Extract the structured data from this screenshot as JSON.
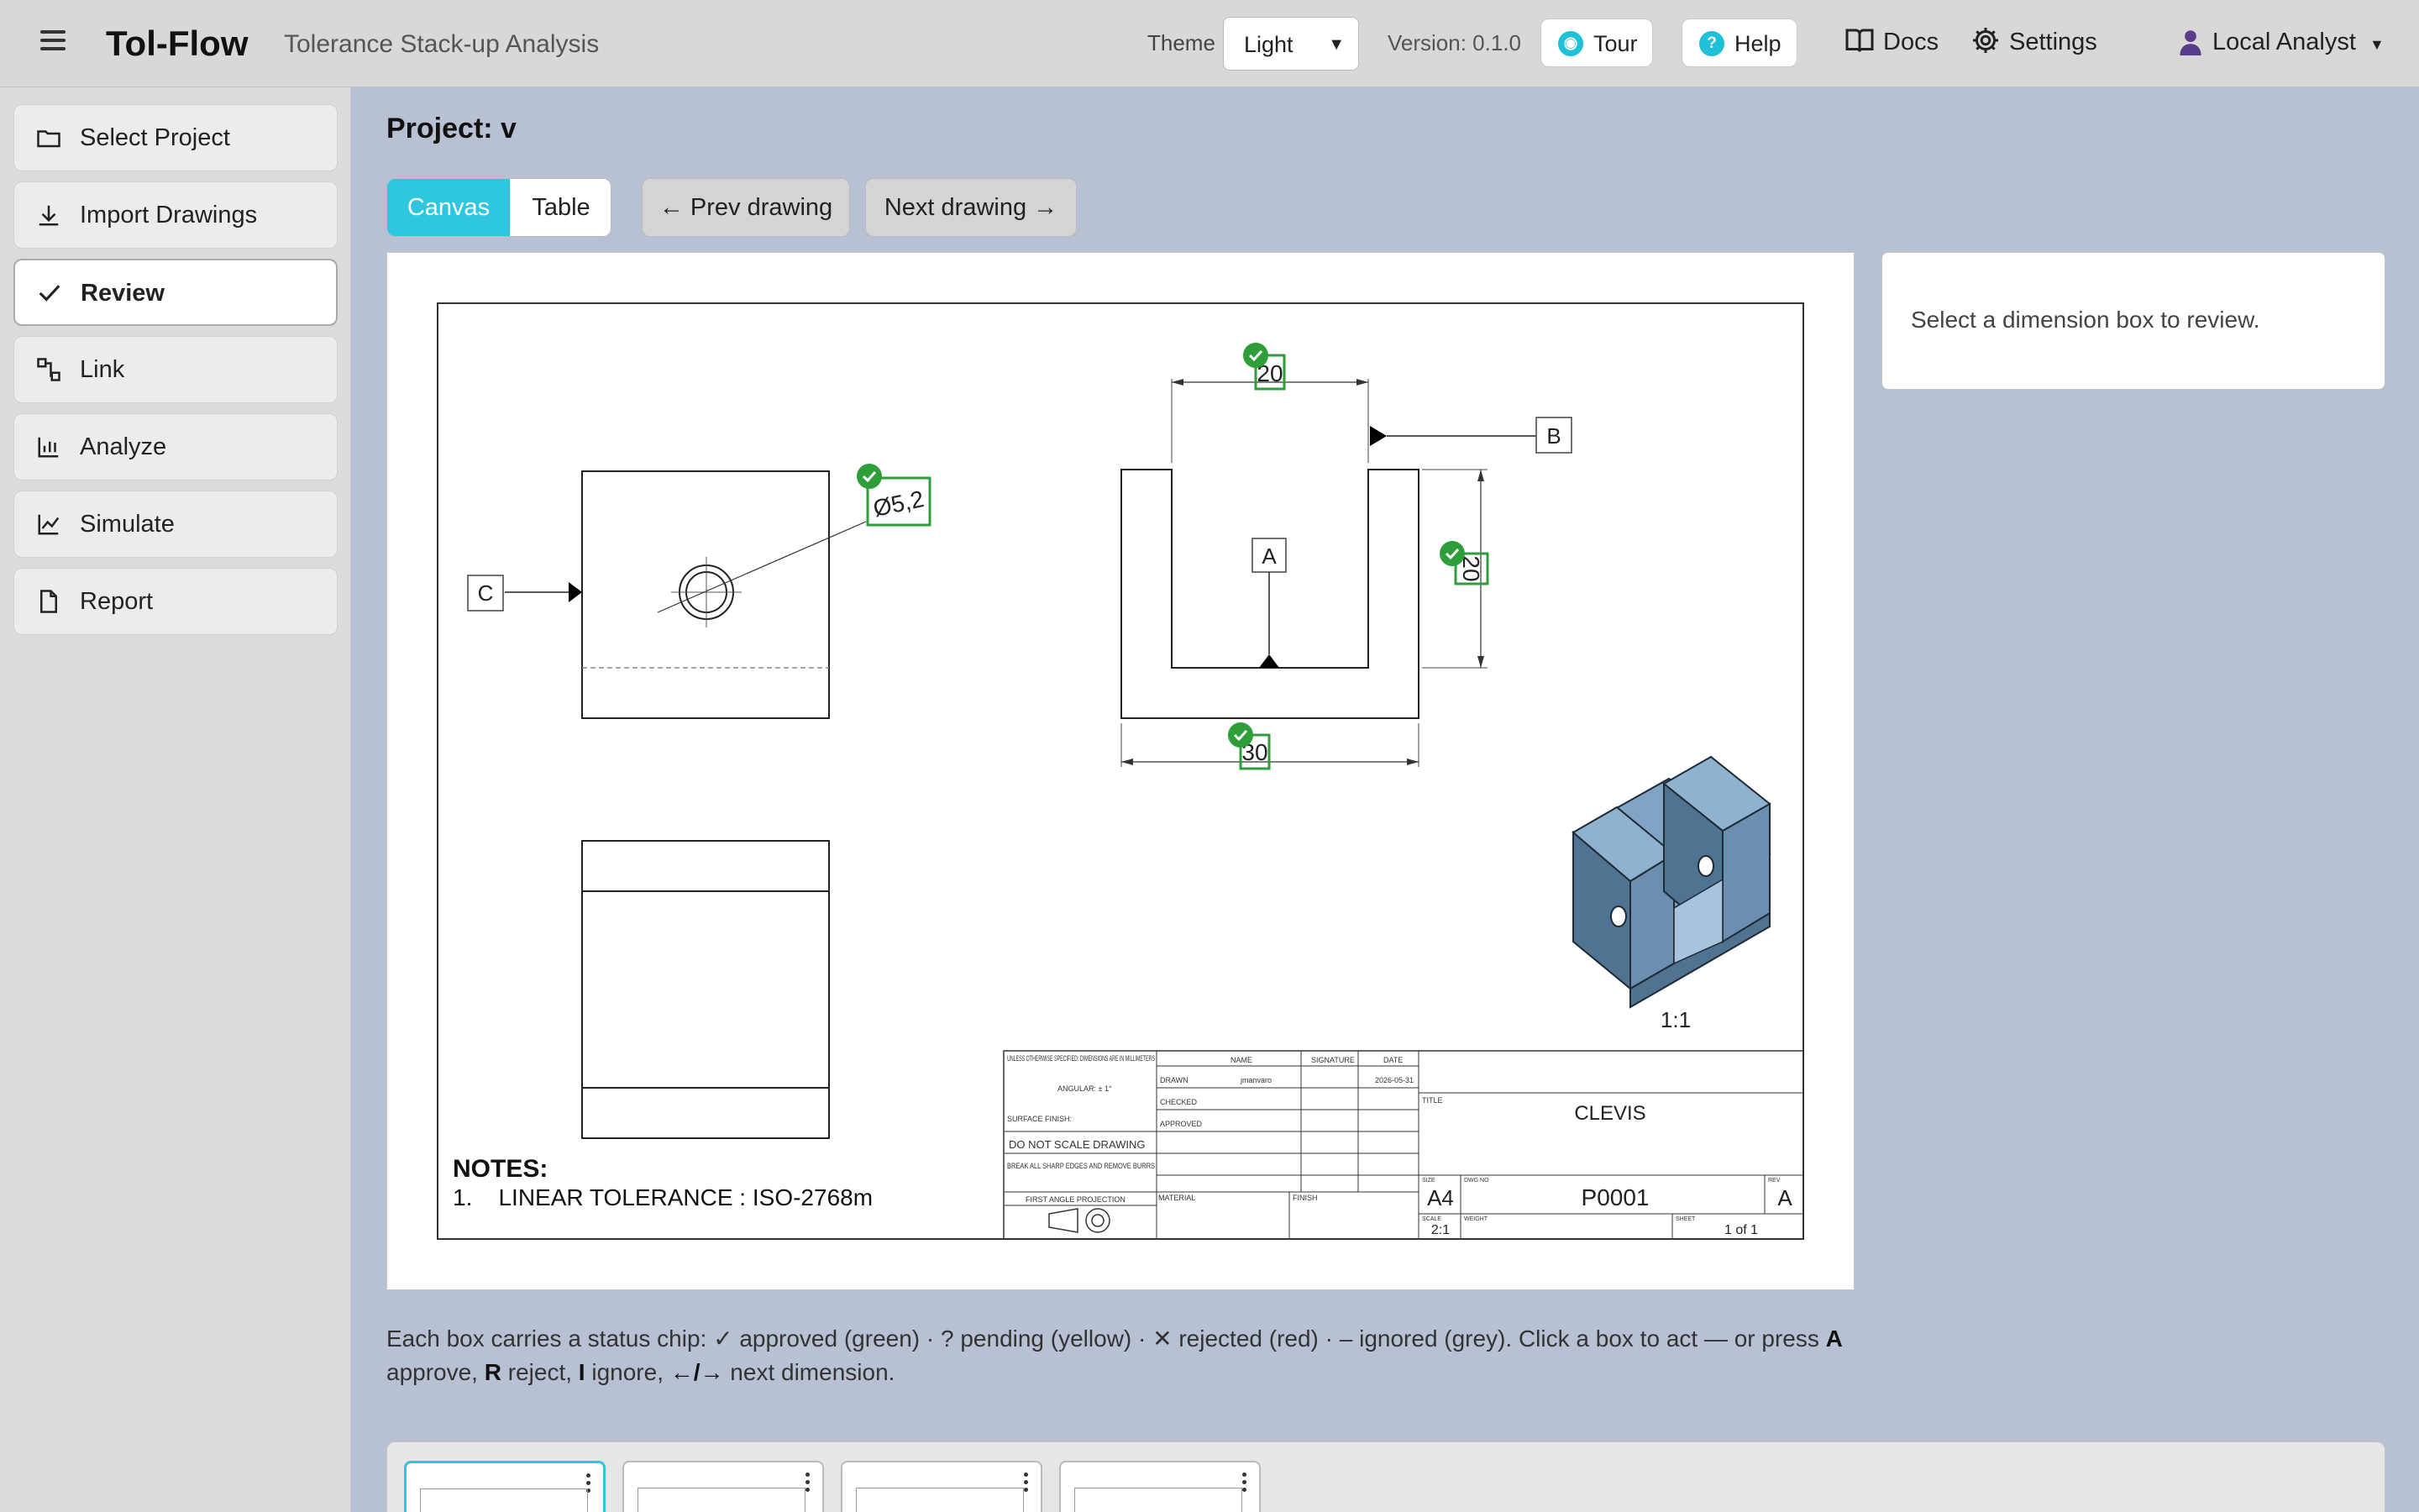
{
  "app": {
    "brand": "Tol-Flow",
    "subtitle": "Tolerance Stack-up Analysis",
    "theme_label": "Theme",
    "theme_value": "Light",
    "version": "Version: 0.1.0",
    "tour": "Tour",
    "help": "Help",
    "docs": "Docs",
    "settings": "Settings",
    "user": "Local Analyst"
  },
  "sidebar": {
    "items": [
      {
        "label": "Select Project",
        "icon": "folder-icon"
      },
      {
        "label": "Import Drawings",
        "icon": "download-icon"
      },
      {
        "label": "Review",
        "icon": "check-icon",
        "active": true
      },
      {
        "label": "Link",
        "icon": "link-icon"
      },
      {
        "label": "Analyze",
        "icon": "bar-chart-icon"
      },
      {
        "label": "Simulate",
        "icon": "line-chart-icon"
      },
      {
        "label": "Report",
        "icon": "file-icon"
      }
    ]
  },
  "main": {
    "project_title": "Project: v",
    "view_tabs": [
      "Canvas",
      "Table"
    ],
    "active_tab": "Canvas",
    "prev": "← Prev drawing",
    "next": "Next drawing →",
    "review_message": "Select a dimension box to review."
  },
  "drawing": {
    "dims": {
      "d1": "Ø5,2",
      "d2": "20",
      "d3": "20",
      "d4": "30"
    },
    "datums": {
      "a": "A",
      "b": "B",
      "c": "C"
    },
    "scale_iso": "1:1",
    "notes_title": "NOTES:",
    "notes_line": "1.    LINEAR TOLERANCE : ISO-2768m",
    "title_block": {
      "unless": "UNLESS OTHERWISE SPECIFIED: DIMENSIONS ARE IN MILLIMETERS",
      "angular": "ANGULAR: ± 1°",
      "surface": "SURFACE FINISH:",
      "no_scale": "DO NOT SCALE DRAWING",
      "break_edges": "BREAK ALL SHARP EDGES AND REMOVE BURRS",
      "projection": "FIRST ANGLE PROJECTION",
      "name": "NAME",
      "signature": "SIGNATURE",
      "date": "DATE",
      "drawn": "DRAWN",
      "drawn_name": "jmanvaro",
      "drawn_date": "2026-05-31",
      "checked": "CHECKED",
      "approved": "APPROVED",
      "material": "MATERIAL",
      "finish": "FINISH",
      "title_label": "TITLE",
      "title": "CLEVIS",
      "size_label": "SIZE",
      "size": "A4",
      "dwg_label": "DWG NO",
      "dwg_no": "P0001",
      "rev_label": "REV",
      "rev": "A",
      "scale_label": "SCALE",
      "scale": "2:1",
      "weight_label": "WEIGHT",
      "sheet_label": "SHEET",
      "sheet": "1 of 1"
    }
  },
  "help_text": {
    "part1": "Each box carries a status chip: ✓ approved (green) · ? pending (yellow) · ✕ rejected (red) · – ignored (grey). Click a box to act — or press ",
    "key_a": "A",
    "part2": " approve, ",
    "key_r": "R",
    "part3": " reject, ",
    "key_i": "I",
    "part4": " ignore, ",
    "key_arrows": "←/→",
    "part5": " next dimension."
  },
  "colors": {
    "accent": "#2fc6e0",
    "approved": "#2e9e3a",
    "iso_fill": "#5f87a8"
  }
}
